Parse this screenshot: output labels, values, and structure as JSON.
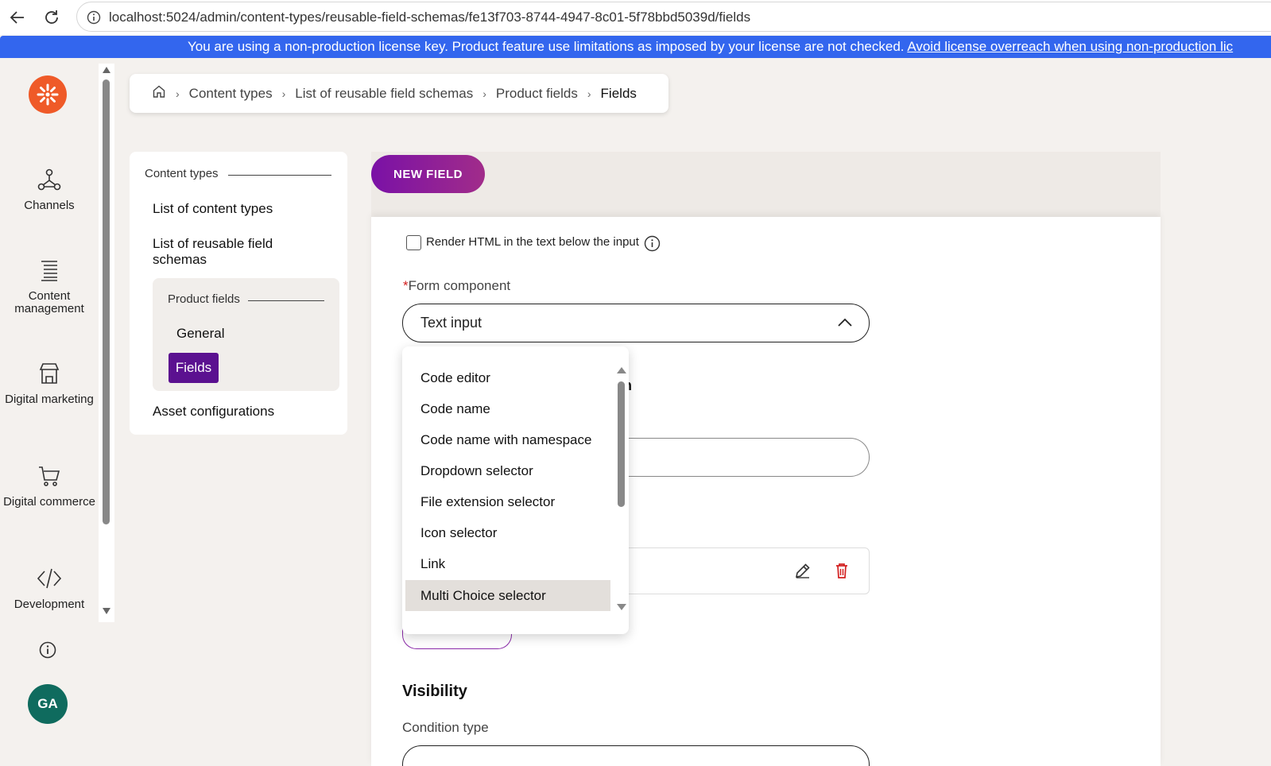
{
  "browser": {
    "url": "localhost:5024/admin/content-types/reusable-field-schemas/fe13f703-8744-4947-8c01-5f78bbd5039d/fields"
  },
  "license": {
    "text": "You are using a non-production license key. Product feature use limitations as imposed by your license are not checked. ",
    "link": "Avoid license overreach when using non-production lic"
  },
  "sidebar": {
    "items": [
      {
        "label": "Channels",
        "icon": "channels-icon"
      },
      {
        "label": "Content management",
        "icon": "content-management-icon"
      },
      {
        "label": "Digital marketing",
        "icon": "digital-marketing-icon"
      },
      {
        "label": "Digital commerce",
        "icon": "cart-icon"
      },
      {
        "label": "Development",
        "icon": "code-icon"
      }
    ],
    "avatar": "GA"
  },
  "breadcrumb": {
    "items": [
      "Content types",
      "List of reusable field schemas",
      "Product fields",
      "Fields"
    ]
  },
  "ct_nav": {
    "heading": "Content types",
    "links": [
      "List of content types",
      "List of reusable field schemas",
      "Asset configurations"
    ],
    "sub_heading": "Product fields",
    "sub_links": [
      "General",
      "Fields"
    ]
  },
  "main": {
    "new_field": "NEW FIELD",
    "render_html_label": "Render HTML in the text below the input",
    "form_component": {
      "required_mark": "*",
      "label": "Form component",
      "value": "Text input",
      "options": [
        "Code editor",
        "Code name",
        "Code name with namespace",
        "Dropdown selector",
        "File extension selector",
        "Icon selector",
        "Link",
        "Multi Choice selector"
      ],
      "selected_option": "Multi Choice selector"
    },
    "hidden_title_fragment": "n",
    "visibility_title": "Visibility",
    "condition_type_label": "Condition type"
  },
  "colors": {
    "brand_orange": "#ef5a28",
    "license_blue": "#3366ee",
    "accent_purple": "#5b1190",
    "delete_red": "#d32020",
    "avatar_green": "#0f6b5e"
  }
}
